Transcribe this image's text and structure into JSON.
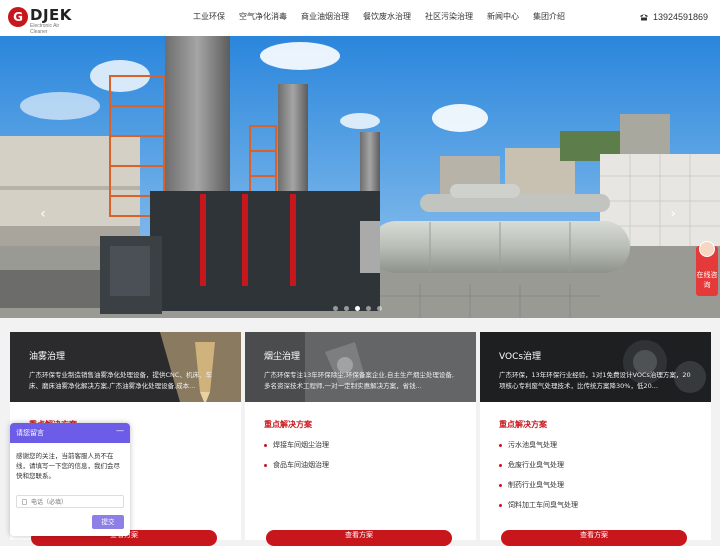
{
  "brand": {
    "name": "DJEK",
    "mark": "G",
    "tagline": "Electronic Air Cleaner"
  },
  "nav": {
    "items": [
      "工业环保",
      "空气净化消毒",
      "商业油烟治理",
      "餐饮废水治理",
      "社区污染治理",
      "新闻中心",
      "集团介绍"
    ]
  },
  "contact": {
    "phone": "13924591869"
  },
  "banner": {
    "prev": "‹",
    "next": "›",
    "dots": 5,
    "active_dot": 3
  },
  "side_tab": {
    "label": "在线咨询"
  },
  "cards": [
    {
      "title": "油雾治理",
      "desc": "广杰环保专业制造销售油雾净化处理设备，提供CNC、机床、车床、磨床油雾净化解决方案,广杰油雾净化处理设备,成本...",
      "sub": "重点解决方案",
      "items": [],
      "button": "查看方案"
    },
    {
      "title": "烟尘治理",
      "desc": "广杰环保专注13年环保除尘,环保备案企业,自主生产烟尘处理设备,多名资深技术工程师,一对一定制实惠解决方案，省钱...",
      "sub": "重点解决方案",
      "items": [
        "焊接车间烟尘治理",
        "食品车间油烟治理"
      ],
      "button": "查看方案"
    },
    {
      "title": "VOCs治理",
      "desc": "广杰环保，13年环保行业经验，1对1免费设计VOCs治理方案，20项核心专利废气处理技术，比传统方案降30%，低20...",
      "sub": "重点解决方案",
      "items": [
        "污水池臭气处理",
        "危废行业臭气处理",
        "制药行业臭气处理",
        "饲料加工车间臭气处理"
      ],
      "button": "查看方案"
    }
  ],
  "chat": {
    "title": "请您留言",
    "minimize": "—",
    "message": "感谢您的关注，当前客服人员不在线，请填写一下您的信息，我们会尽快和您联系。",
    "phone_placeholder": "电话（必填）",
    "submit": "提交"
  }
}
